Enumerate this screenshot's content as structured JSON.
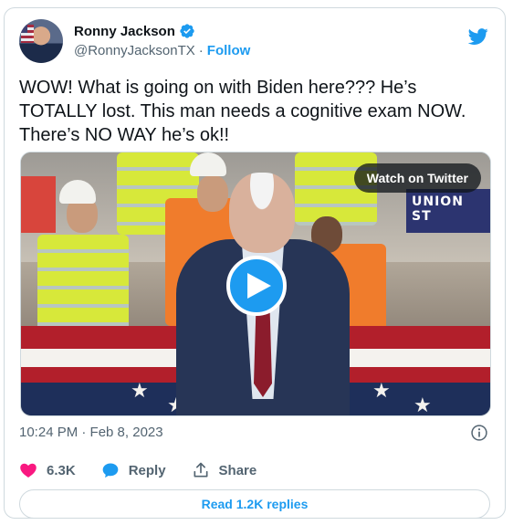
{
  "author": {
    "name": "Ronny Jackson",
    "handle": "@RonnyJacksonTX",
    "separator": "·",
    "follow_label": "Follow",
    "verified": true,
    "avatar_icon": "avatar-photo"
  },
  "tweet": {
    "text": "WOW! What is going on with Biden here??? He’s TOTALLY lost. This man needs a cognitive exam NOW. There’s NO WAY he’s ok!!"
  },
  "media": {
    "watch_label": "Watch on Twitter",
    "sign_text": "UNION ST",
    "play_icon": "play-icon"
  },
  "meta": {
    "timestamp": "10:24 PM · Feb 8, 2023",
    "info_icon": "info-icon"
  },
  "actions": {
    "likes": "6.3K",
    "reply_label": "Reply",
    "share_label": "Share"
  },
  "replies": {
    "label": "Read 1.2K replies"
  },
  "colors": {
    "accent": "#1d9bf0",
    "like": "#f91880",
    "muted": "#536471",
    "text": "#0f1419",
    "border": "#cfd9de"
  }
}
